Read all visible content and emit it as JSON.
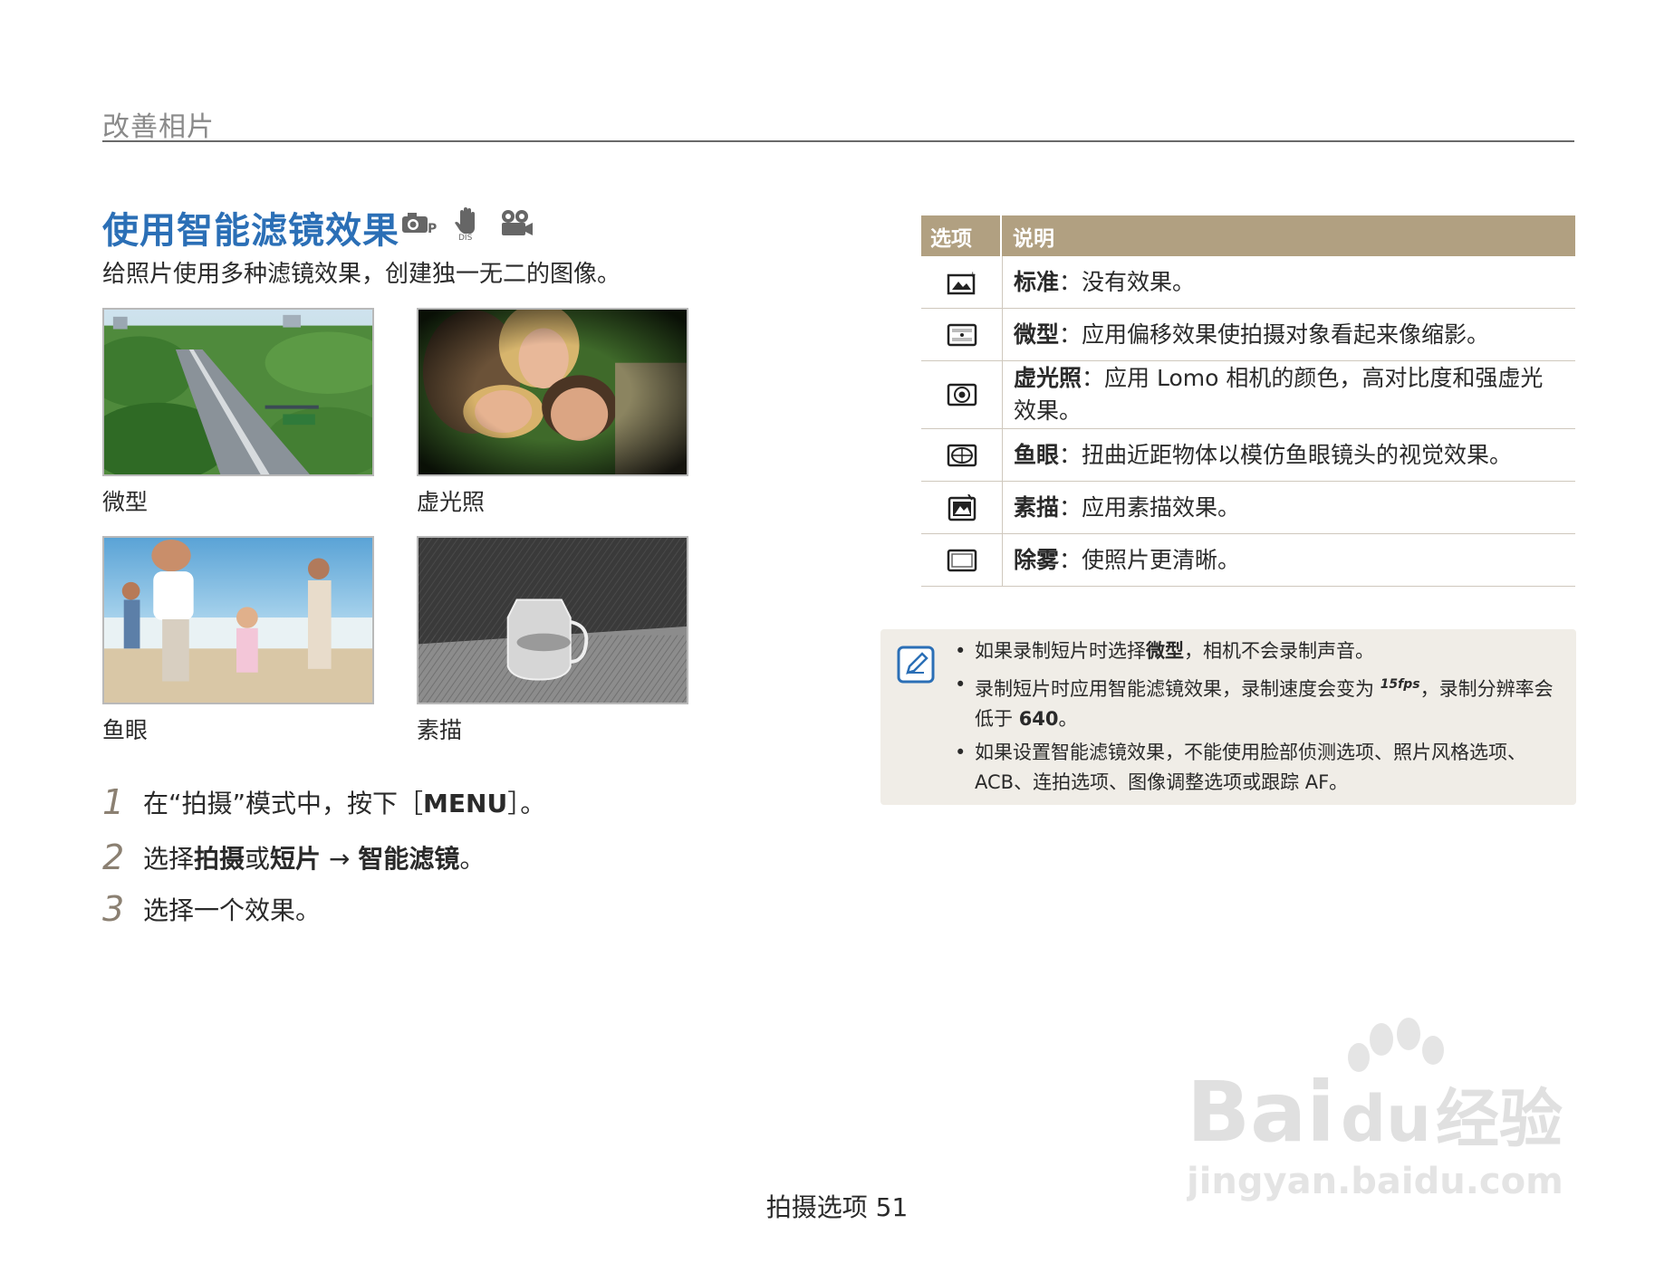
{
  "header": {
    "chapter": "改善相片"
  },
  "section": {
    "title": "使用智能滤镜效果",
    "intro": "给照片使用多种滤镜效果，创建独一无二的图像。",
    "mode_icons": [
      "camera-p-icon",
      "dis-hand-icon",
      "movie-camera-icon"
    ]
  },
  "photos": [
    {
      "caption": "微型",
      "image": "miniature-highway-photo"
    },
    {
      "caption": "虚光照",
      "image": "vignette-couple-photo"
    },
    {
      "caption": "鱼眼",
      "image": "fisheye-family-beach-photo"
    },
    {
      "caption": "素描",
      "image": "sketch-pitcher-photo"
    }
  ],
  "steps": [
    {
      "num": "1",
      "parts": [
        {
          "t": "在“拍摄”模式中，按下［"
        },
        {
          "t": "MENU",
          "b": true
        },
        {
          "t": "］。"
        }
      ]
    },
    {
      "num": "2",
      "parts": [
        {
          "t": "选择"
        },
        {
          "t": "拍摄",
          "b": true
        },
        {
          "t": "或"
        },
        {
          "t": "短片",
          "b": true
        },
        {
          "t": " → "
        },
        {
          "t": "智能滤镜",
          "b": true
        },
        {
          "t": "。"
        }
      ]
    },
    {
      "num": "3",
      "parts": [
        {
          "t": "选择一个效果。"
        }
      ]
    }
  ],
  "table": {
    "headers": [
      "选项",
      "说明"
    ],
    "rows": [
      {
        "icon": "normal-filter-icon",
        "term": "标准",
        "desc": "：没有效果。"
      },
      {
        "icon": "miniature-filter-icon",
        "term": "微型",
        "desc": "：应用偏移效果使拍摄对象看起来像缩影。"
      },
      {
        "icon": "vignette-filter-icon",
        "term": "虚光照",
        "desc": "：应用 Lomo 相机的颜色，高对比度和强虚光效果。"
      },
      {
        "icon": "fisheye-filter-icon",
        "term": "鱼眼",
        "desc": "：扭曲近距物体以模仿鱼眼镜头的视觉效果。"
      },
      {
        "icon": "sketch-filter-icon",
        "term": "素描",
        "desc": "：应用素描效果。"
      },
      {
        "icon": "defog-filter-icon",
        "term": "除雾",
        "desc": "：使照片更清晰。"
      }
    ]
  },
  "notes": [
    [
      {
        "t": "如果录制短片时选择"
      },
      {
        "t": "微型",
        "b": true
      },
      {
        "t": "，相机不会录制声音。"
      }
    ],
    [
      {
        "t": "录制短片时应用智能滤镜效果，录制速度会变为 "
      },
      {
        "t": "15fps",
        "icon": true
      },
      {
        "t": "，录制分辨率会低于 "
      },
      {
        "t": "640",
        "b": true
      },
      {
        "t": "。"
      }
    ],
    [
      {
        "t": "如果设置智能滤镜效果，不能使用脸部侦测选项、照片风格选项、ACB、连拍选项、图像调整选项或跟踪 AF。"
      }
    ]
  ],
  "footer": {
    "text": "拍摄选项  51"
  },
  "watermark": {
    "brand": "Bai",
    "brand2": "du",
    "cn": "经验",
    "url": "jingyan.baidu.com"
  },
  "colors": {
    "accent": "#2b6fb6",
    "table_header": "#b1a081",
    "note_bg": "#f0ede7",
    "step_num": "#8b8072"
  }
}
